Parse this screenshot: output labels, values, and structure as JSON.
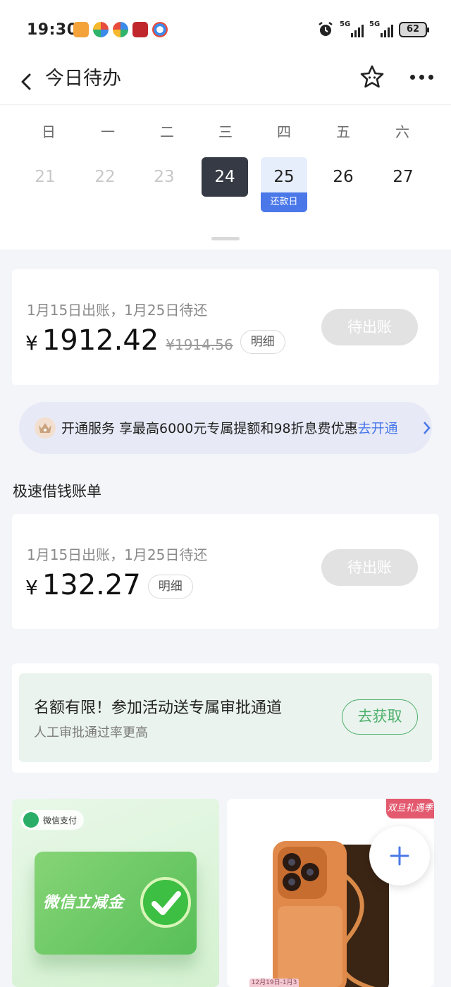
{
  "status_bar": {
    "time": "19:30",
    "signal_1": "5G",
    "signal_2": "5G",
    "battery": "62",
    "app_icons": [
      "app-orange-icon",
      "app-multicolor-icon",
      "app-multicolor-icon",
      "bank-app-icon",
      "browser-icon"
    ]
  },
  "header": {
    "title": "今日待办"
  },
  "calendar": {
    "weekdays": [
      "日",
      "一",
      "二",
      "三",
      "四",
      "五",
      "六"
    ],
    "days": [
      "21",
      "22",
      "23",
      "24",
      "25",
      "26",
      "27"
    ],
    "due_badge": "还款日"
  },
  "bill_main": {
    "line": "1月15日出账，1月25日待还",
    "currency": "¥",
    "amount": "1912.42",
    "original_amount": "¥1914.56",
    "detail": "明细",
    "status_button": "待出账"
  },
  "promo": {
    "text": "开通服务 享最高6000元专属提额和98折息费优惠",
    "link": "去开通"
  },
  "section": {
    "title": "极速借钱账单"
  },
  "bill_fast": {
    "line": "1月15日出账，1月25日待还",
    "currency": "¥",
    "amount": "132.27",
    "detail": "明细",
    "status_button": "待出账"
  },
  "activity": {
    "title": "名额有限！参加活动送专属审批通道",
    "subtitle": "人工审批通过率更高",
    "button": "去获取"
  },
  "tiles": {
    "wechat": {
      "chip": "微信支付",
      "card_text": "微信立减金"
    },
    "phone": {
      "season_tag": "双旦礼遇季",
      "date_range": "12月19日-1月3日"
    }
  },
  "colors": {
    "accent_blue": "#4a78e8",
    "today_bg": "#363a45",
    "green": "#4fb06c",
    "pending_gray": "#e2e2e2"
  }
}
